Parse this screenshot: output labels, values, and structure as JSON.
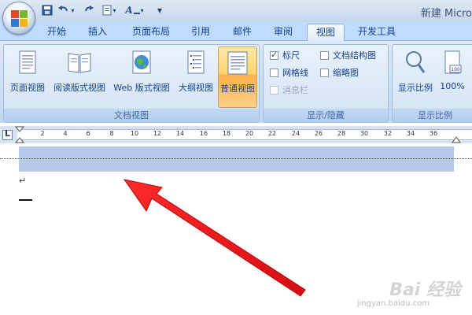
{
  "window": {
    "title": "新建 Micro"
  },
  "quick_access": {
    "icons": [
      "save-icon",
      "undo-icon",
      "redo-icon",
      "customize-icon",
      "text-style-icon"
    ],
    "more": "▾"
  },
  "tabs": [
    {
      "label": "开始",
      "active": false
    },
    {
      "label": "插入",
      "active": false
    },
    {
      "label": "页面布局",
      "active": false
    },
    {
      "label": "引用",
      "active": false
    },
    {
      "label": "邮件",
      "active": false
    },
    {
      "label": "审阅",
      "active": false
    },
    {
      "label": "视图",
      "active": true
    },
    {
      "label": "开发工具",
      "active": false
    }
  ],
  "ribbon": {
    "document_views": {
      "title": "文档视图",
      "buttons": [
        {
          "label": "页面视图",
          "icon": "page-view-icon",
          "selected": false
        },
        {
          "label": "阅读版式视图",
          "icon": "reading-view-icon",
          "selected": false
        },
        {
          "label": "Web 版式视图",
          "icon": "web-view-icon",
          "selected": false
        },
        {
          "label": "大纲视图",
          "icon": "outline-view-icon",
          "selected": false
        },
        {
          "label": "普通视图",
          "icon": "draft-view-icon",
          "selected": true
        }
      ]
    },
    "show_hide": {
      "title": "显示/隐藏",
      "items": [
        {
          "label": "标尺",
          "checked": true,
          "enabled": true
        },
        {
          "label": "网格线",
          "checked": false,
          "enabled": true
        },
        {
          "label": "消息栏",
          "checked": false,
          "enabled": false
        },
        {
          "label": "文档结构图",
          "checked": false,
          "enabled": true
        },
        {
          "label": "缩略图",
          "checked": false,
          "enabled": true
        }
      ]
    },
    "zoom": {
      "title": "显示比例",
      "buttons": [
        {
          "label": "显示比例",
          "icon": "magnifier-icon"
        },
        {
          "label": "100%",
          "icon": "zoom-100-icon"
        }
      ]
    }
  },
  "ruler": {
    "tab_selector": "L",
    "tick_labels": [
      "2",
      "4",
      "6",
      "8",
      "10",
      "12",
      "14",
      "16",
      "18",
      "20",
      "22",
      "24",
      "26",
      "28",
      "30",
      "32",
      "34",
      "36"
    ]
  },
  "document": {
    "paragraph_mark": "↵"
  },
  "annotation": {
    "color": "#e8141c"
  },
  "watermark": {
    "main": "Bai 经验",
    "sub": "jingyan.baidu.com"
  }
}
